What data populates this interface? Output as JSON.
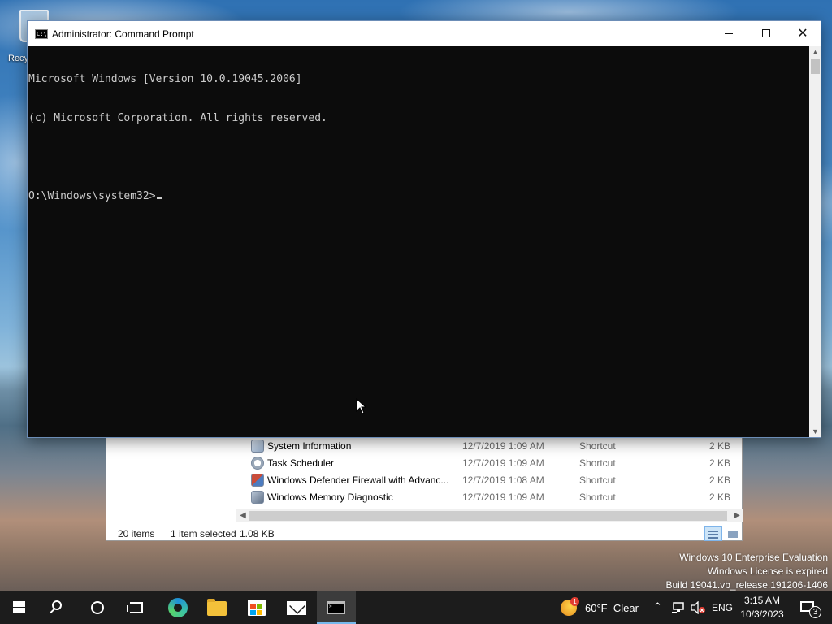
{
  "desktop": {
    "recycle_bin_label": "Recy"
  },
  "cmd_window": {
    "title": "Administrator: Command Prompt",
    "icon_text": "C:\\",
    "console_lines": [
      "Microsoft Windows [Version 10.0.19045.2006]",
      "(c) Microsoft Corporation. All rights reserved.",
      "",
      "O:\\Windows\\system32>"
    ]
  },
  "explorer": {
    "files": [
      {
        "name": "System Information",
        "date": "12/7/2019 1:09 AM",
        "type": "Shortcut",
        "size": "2 KB",
        "icon": "system-info-icon"
      },
      {
        "name": "Task Scheduler",
        "date": "12/7/2019 1:09 AM",
        "type": "Shortcut",
        "size": "2 KB",
        "icon": "task-scheduler-icon"
      },
      {
        "name": "Windows Defender Firewall with Advanc...",
        "date": "12/7/2019 1:08 AM",
        "type": "Shortcut",
        "size": "2 KB",
        "icon": "firewall-icon"
      },
      {
        "name": "Windows Memory Diagnostic",
        "date": "12/7/2019 1:09 AM",
        "type": "Shortcut",
        "size": "2 KB",
        "icon": "memory-diagnostic-icon"
      }
    ],
    "status": {
      "item_count": "20 items",
      "selected": "1 item selected",
      "selected_size": "1.08 KB"
    }
  },
  "watermark": {
    "line1": "Windows 10 Enterprise Evaluation",
    "line2": "Windows License is expired",
    "line3": "Build 19041.vb_release.191206-1406"
  },
  "taskbar": {
    "weather": {
      "temp": "60°F",
      "condition": "Clear",
      "badge": "1"
    },
    "language": "ENG",
    "time": "3:15 AM",
    "date": "10/3/2023",
    "notification_count": "3"
  },
  "colors": {
    "console_bg": "#0c0c0c",
    "console_fg": "#cccccc",
    "taskbar_bg": "#1c1c1c",
    "active_indicator": "#76b9ed"
  }
}
